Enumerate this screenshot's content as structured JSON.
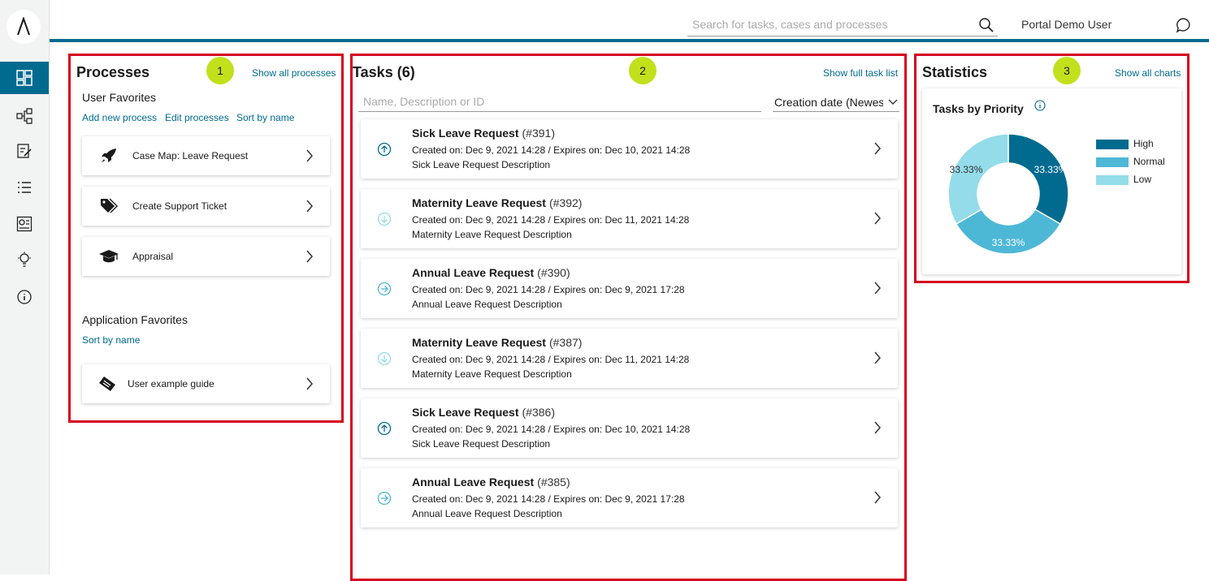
{
  "topbar": {
    "search_placeholder": "Search for tasks, cases and processes",
    "user_name": "Portal Demo User"
  },
  "sidebar": {
    "items": [
      {
        "icon": "dashboard-icon",
        "active": true
      },
      {
        "icon": "processes-icon"
      },
      {
        "icon": "tasks-icon"
      },
      {
        "icon": "cases-icon"
      },
      {
        "icon": "statistics-icon"
      },
      {
        "icon": "idea-icon"
      },
      {
        "icon": "info-icon"
      }
    ]
  },
  "processes": {
    "badge": "1",
    "title": "Processes",
    "show_all": "Show all processes",
    "user_favorites_title": "User Favorites",
    "add_new": "Add new process",
    "edit": "Edit processes",
    "sort_by_name": "Sort by name",
    "items": [
      {
        "label": "Case Map: Leave Request",
        "icon": "rocket-icon"
      },
      {
        "label": "Create Support Ticket",
        "icon": "tags-icon"
      },
      {
        "label": "Appraisal",
        "icon": "graduation-cap-icon"
      }
    ],
    "app_favorites_title": "Application Favorites",
    "app_sort_by_name": "Sort by name",
    "app_items": [
      {
        "label": "User example guide",
        "icon": "ticket-icon"
      }
    ]
  },
  "tasks": {
    "badge": "2",
    "title": "Tasks (6)",
    "show_full": "Show full task list",
    "filter_placeholder": "Name, Description or ID",
    "sort_value": "Creation date (Newest first)",
    "items": [
      {
        "name": "Sick Leave Request",
        "id": "(#391)",
        "dates": "Created on: Dec 9, 2021 14:28 / Expires on: Dec 10, 2021 14:28",
        "desc": "Sick Leave Request Description",
        "priority": "high"
      },
      {
        "name": "Maternity Leave Request",
        "id": "(#392)",
        "dates": "Created on: Dec 9, 2021 14:28 / Expires on: Dec 11, 2021 14:28",
        "desc": "Maternity Leave Request Description",
        "priority": "low"
      },
      {
        "name": "Annual Leave Request",
        "id": "(#390)",
        "dates": "Created on: Dec 9, 2021 14:28 / Expires on: Dec 9, 2021 17:28",
        "desc": "Annual Leave Request Description",
        "priority": "normal"
      },
      {
        "name": "Maternity Leave Request",
        "id": "(#387)",
        "dates": "Created on: Dec 9, 2021 14:28 / Expires on: Dec 11, 2021 14:28",
        "desc": "Maternity Leave Request Description",
        "priority": "low"
      },
      {
        "name": "Sick Leave Request",
        "id": "(#386)",
        "dates": "Created on: Dec 9, 2021 14:28 / Expires on: Dec 10, 2021 14:28",
        "desc": "Sick Leave Request Description",
        "priority": "high"
      },
      {
        "name": "Annual Leave Request",
        "id": "(#385)",
        "dates": "Created on: Dec 9, 2021 14:28 / Expires on: Dec 9, 2021 17:28",
        "desc": "Annual Leave Request Description",
        "priority": "normal"
      }
    ]
  },
  "statistics": {
    "badge": "3",
    "title": "Statistics",
    "show_all": "Show all charts",
    "chart_title": "Tasks by Priority",
    "legend": [
      {
        "label": "High",
        "color": "#006b8f"
      },
      {
        "label": "Normal",
        "color": "#4db8d6"
      },
      {
        "label": "Low",
        "color": "#94dce9"
      }
    ]
  },
  "chart_data": {
    "type": "pie",
    "title": "Tasks by Priority",
    "categories": [
      "High",
      "Normal",
      "Low"
    ],
    "values": [
      33.33,
      33.33,
      33.33
    ],
    "labels": [
      "33.33%",
      "33.33%",
      "33.33%"
    ],
    "colors": [
      "#006b8f",
      "#4db8d6",
      "#94dce9"
    ],
    "legend_position": "right"
  },
  "colors": {
    "accent": "#006b8f",
    "highlight_border": "#d6001c",
    "badge": "#c3e01c"
  }
}
